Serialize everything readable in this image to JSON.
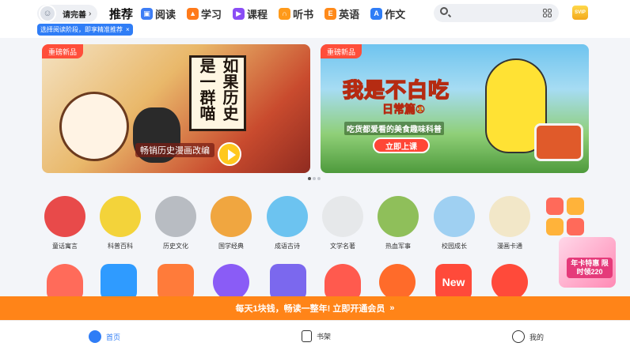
{
  "header": {
    "profile_label": "请完善",
    "tip_text": "选择阅读阶段，即享精准推荐",
    "tip_close": "×",
    "nav": [
      {
        "label": "推荐",
        "active": true
      },
      {
        "label": "阅读",
        "icon": "book-icon",
        "color": "#3d7df5"
      },
      {
        "label": "学习",
        "icon": "graduation-cap-icon",
        "color": "#ff7a1a"
      },
      {
        "label": "课程",
        "icon": "play-icon",
        "color": "#8a4df5"
      },
      {
        "label": "听书",
        "icon": "headphones-icon",
        "color": "#ff9a1a"
      },
      {
        "label": "英语",
        "icon": "english-icon",
        "color": "#ff8a1a"
      },
      {
        "label": "作文",
        "icon": "pen-icon",
        "color": "#2f7df6"
      }
    ],
    "search_placeholder": "",
    "vip_label": "SVIP"
  },
  "banners": [
    {
      "badge": "重磅新品",
      "title": "如果历史是一群喵",
      "subtitle": "畅销历史漫画改编"
    },
    {
      "badge": "重磅新品",
      "title": "我是不白吃",
      "title2": "日常篇①",
      "subtitle": "吃货都爱看的美食趣味科普",
      "button": "立即上课"
    }
  ],
  "carousel": {
    "count": 3,
    "active": 0
  },
  "categories": [
    {
      "label": "童话寓言",
      "color": "#e84a4a"
    },
    {
      "label": "科普百科",
      "color": "#f3d33a"
    },
    {
      "label": "历史文化",
      "color": "#b8bcc2"
    },
    {
      "label": "国学经典",
      "color": "#f0a640"
    },
    {
      "label": "成语古诗",
      "color": "#6cc3f0"
    },
    {
      "label": "文学名著",
      "color": "#e6e8ea"
    },
    {
      "label": "热血军事",
      "color": "#8fbf5a"
    },
    {
      "label": "校园成长",
      "color": "#9fd0f2"
    },
    {
      "label": "漫画卡通",
      "color": "#f2e7c8"
    },
    {
      "label": "全部",
      "color": "#ffb33a"
    }
  ],
  "bottom_icons": [
    {
      "name": "crab-icon",
      "color": "#ff6b5a"
    },
    {
      "name": "graduation-cap-icon",
      "color": "#2f9bff"
    },
    {
      "name": "notebook-icon",
      "color": "#ff7b3a"
    },
    {
      "name": "star-icon",
      "color": "#8a5cf6"
    },
    {
      "name": "calendar-icon",
      "color": "#7b68ee"
    },
    {
      "name": "heart-icon",
      "color": "#ff5a4e"
    },
    {
      "name": "fire-icon",
      "color": "#ff6b2a"
    },
    {
      "name": "new-icon",
      "color": "#ff4a3a",
      "text": "New"
    },
    {
      "name": "compass-icon",
      "color": "#ff4a3a"
    }
  ],
  "promo": {
    "text": "每天1块钱，畅读一整年! 立即开通会员",
    "arrow": "»"
  },
  "floating": {
    "text": "年卡特惠 限时领220"
  },
  "tabbar": [
    {
      "label": "首页",
      "icon": "home-icon",
      "active": true
    },
    {
      "label": "书架",
      "icon": "bookshelf-icon",
      "active": false
    },
    {
      "label": "我的",
      "icon": "profile-icon",
      "active": false
    }
  ]
}
